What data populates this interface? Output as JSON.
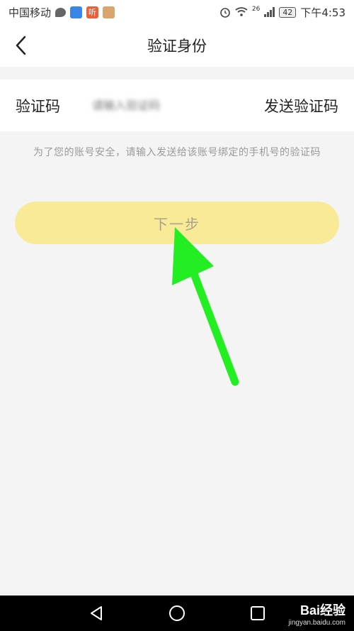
{
  "status": {
    "carrier": "中国移动",
    "network": "26",
    "battery": "42",
    "time": "下午4:53"
  },
  "header": {
    "title": "验证身份"
  },
  "form": {
    "code_label": "验证码",
    "code_placeholder": "请输入验证码",
    "send_label": "发送验证码",
    "hint": "为了您的账号安全，请输入发送给该账号绑定的手机号的验证码",
    "next_label": "下一步"
  },
  "colors": {
    "next_button": "#f8ea96",
    "arrow": "#22ee22"
  },
  "watermark": {
    "brand": "Bai经验",
    "site": "jingyan.baidu.com"
  }
}
